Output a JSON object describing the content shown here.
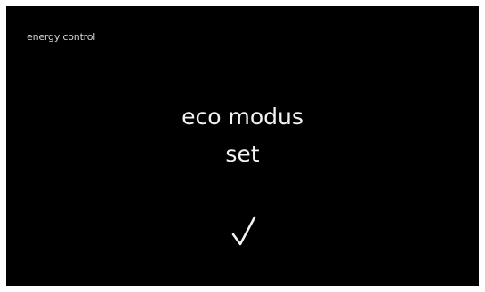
{
  "header": {
    "title": "energy control"
  },
  "status": {
    "line1": "eco modus",
    "line2": "set",
    "icon": "checkmark-icon"
  },
  "colors": {
    "background": "#000000",
    "text": "#f2f2f2",
    "header_text": "#d6d6d6"
  }
}
